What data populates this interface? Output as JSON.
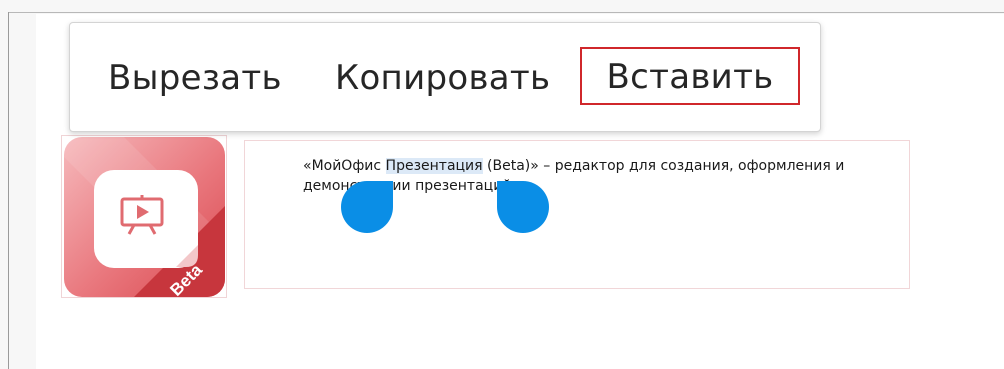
{
  "context_menu": {
    "cut_label": "Вырезать",
    "copy_label": "Копировать",
    "paste_label": "Вставить",
    "highlight_color": "#d0272b"
  },
  "app_icon": {
    "badge_text": "Beta",
    "icon": "presentation-screen-icon",
    "colors": {
      "primary": "#e05a61",
      "light": "#f4b6b9",
      "dark": "#c4343c"
    }
  },
  "description": {
    "before": "«МойОфис ",
    "selected": "Презентация",
    "after_line1": " (Beta)» – редактор для создания, оформления и",
    "line2": "демонстрации презентаций"
  },
  "selection": {
    "handle_color": "#0a8ee6",
    "highlight_color": "#dce9f7"
  }
}
